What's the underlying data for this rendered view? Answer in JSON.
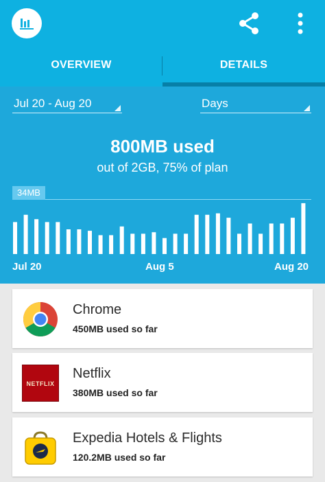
{
  "appbar": {
    "app_icon": "bar-chart-icon",
    "actions": [
      "share-icon",
      "more-vert-icon"
    ]
  },
  "tabs": [
    {
      "label": "OVERVIEW",
      "selected": false
    },
    {
      "label": "DETAILS",
      "selected": true
    }
  ],
  "filters": {
    "date_range": "Jul 20 - Aug 20",
    "unit": "Days"
  },
  "summary": {
    "headline": "800MB used",
    "subline": "out of 2GB, 75% of plan"
  },
  "chart_data": {
    "type": "bar",
    "cap_label": "34MB",
    "x_tick_labels": [
      "Jul 20",
      "Aug 5",
      "Aug 20"
    ],
    "ylim": [
      0,
      34
    ],
    "values": [
      22,
      27,
      24,
      22,
      22,
      17,
      17,
      16,
      13,
      13,
      19,
      14,
      14,
      15,
      11,
      14,
      14,
      27,
      27,
      28,
      25,
      14,
      21,
      14,
      21,
      21,
      25,
      35
    ]
  },
  "apps": [
    {
      "name": "Chrome",
      "usage": "450MB used so far",
      "icon": "chrome-icon"
    },
    {
      "name": "Netflix",
      "usage": "380MB used so far",
      "icon": "netflix-icon",
      "icon_text": "NETFLIX"
    },
    {
      "name": "Expedia Hotels & Flights",
      "usage": "120.2MB used so far",
      "icon": "expedia-icon"
    }
  ],
  "colors": {
    "primary": "#0eb1e1",
    "summary_bg": "#1ea8db",
    "tab_indicator": "#077fa7",
    "background": "#e9e9e9"
  }
}
